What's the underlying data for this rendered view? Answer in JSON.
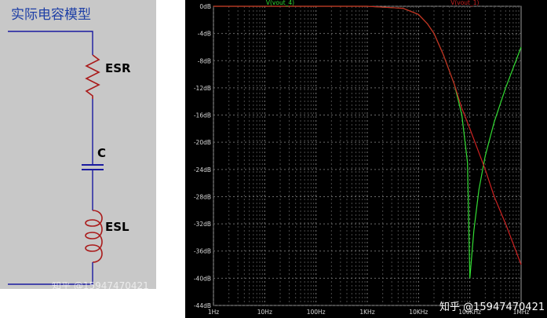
{
  "circuit": {
    "title": "实际电容模型",
    "components": {
      "esr": "ESR",
      "c": "C",
      "esl": "ESL"
    }
  },
  "watermarks": {
    "left": "知乎 @15947470421",
    "right": "知乎 @15947470421"
  },
  "chart_data": {
    "type": "line",
    "x_scale": "log",
    "xlim": [
      1,
      1000000
    ],
    "ylim": [
      -44,
      0
    ],
    "x_ticks": [
      {
        "value": 1,
        "label": "1Hz"
      },
      {
        "value": 10,
        "label": "10Hz"
      },
      {
        "value": 100,
        "label": "100Hz"
      },
      {
        "value": 1000,
        "label": "1KHz"
      },
      {
        "value": 10000,
        "label": "10KHz"
      },
      {
        "value": 100000,
        "label": "100KHz"
      },
      {
        "value": 1000000,
        "label": "1MHz"
      }
    ],
    "y_ticks": [
      {
        "value": 0,
        "label": "0dB"
      },
      {
        "value": -4,
        "label": "-4dB"
      },
      {
        "value": -8,
        "label": "-8dB"
      },
      {
        "value": -12,
        "label": "-12dB"
      },
      {
        "value": -16,
        "label": "-16dB"
      },
      {
        "value": -20,
        "label": "-20dB"
      },
      {
        "value": -24,
        "label": "-24dB"
      },
      {
        "value": -28,
        "label": "-28dB"
      },
      {
        "value": -32,
        "label": "-32dB"
      },
      {
        "value": -36,
        "label": "-36dB"
      },
      {
        "value": -40,
        "label": "-40dB"
      },
      {
        "value": -44,
        "label": "-44dB"
      }
    ],
    "grid": true,
    "series": [
      {
        "name": "V(vout_4)",
        "color": "#33dd33",
        "x": [
          1,
          1000,
          5000,
          10000,
          15000,
          20000,
          30000,
          50000,
          70000,
          90000,
          100000,
          120000,
          150000,
          200000,
          300000,
          500000,
          1000000
        ],
        "y": [
          0,
          0,
          -0.3,
          -1.2,
          -2.6,
          -4.0,
          -7.0,
          -11.5,
          -16,
          -23,
          -40,
          -33,
          -27,
          -22,
          -17,
          -12,
          -6
        ]
      },
      {
        "name": "V(vout_1)",
        "color": "#cc2222",
        "x": [
          1,
          1000,
          5000,
          10000,
          15000,
          20000,
          30000,
          50000,
          70000,
          100000,
          200000,
          300000,
          500000,
          1000000
        ],
        "y": [
          0,
          0,
          -0.3,
          -1.2,
          -2.6,
          -4.0,
          -7.0,
          -11.5,
          -15,
          -18,
          -24,
          -28,
          -32,
          -38
        ]
      }
    ]
  }
}
